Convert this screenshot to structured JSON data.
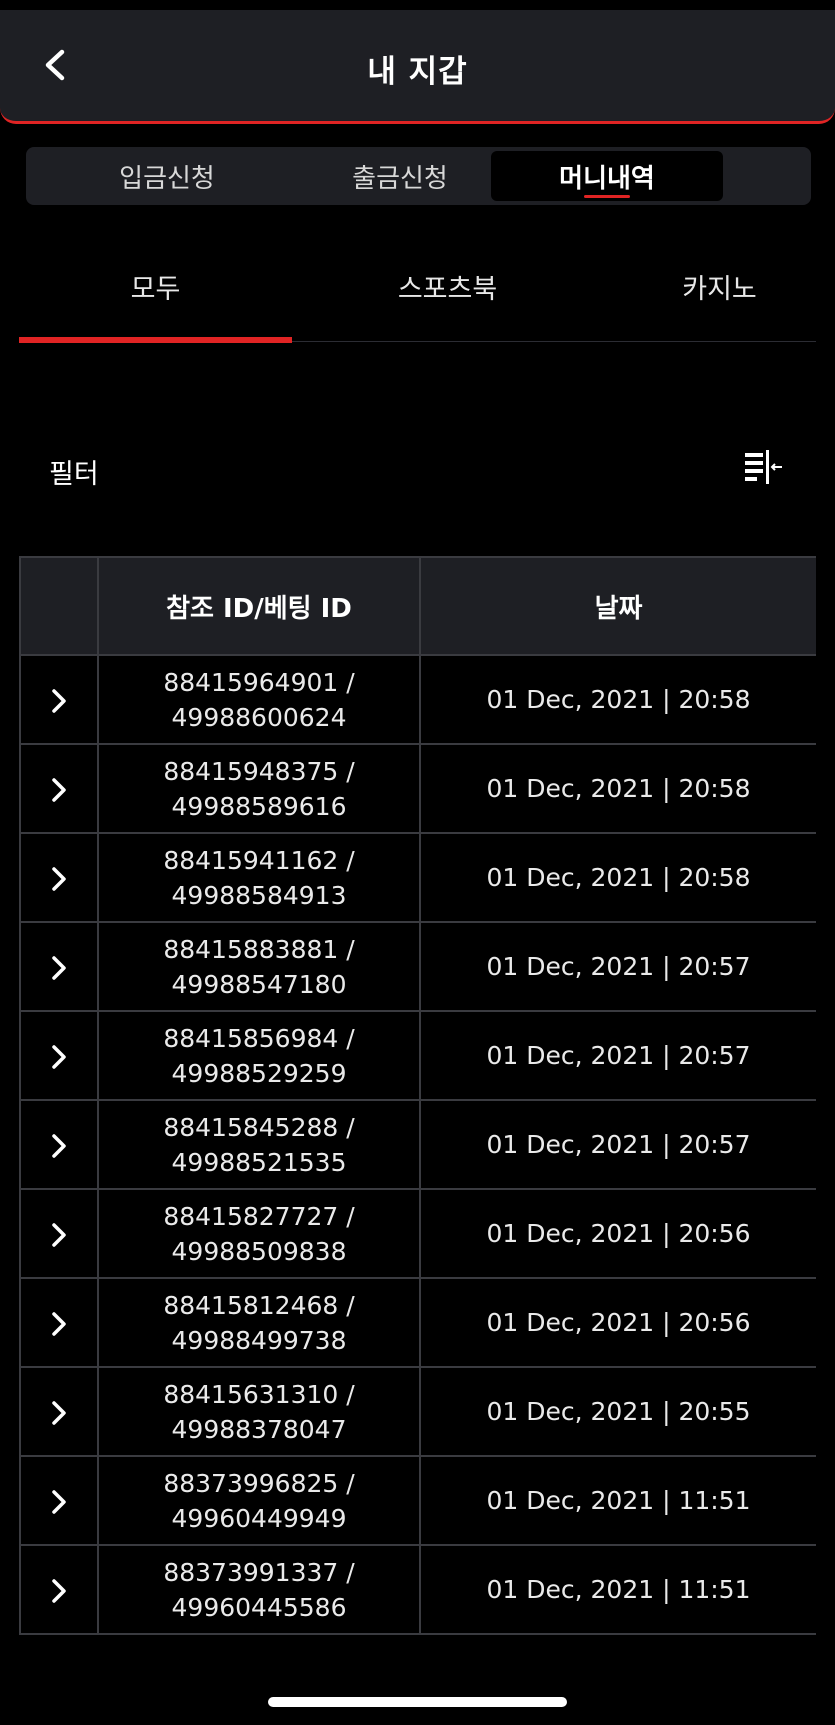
{
  "header": {
    "title": "내 지갑",
    "back_icon": "chevron-left-icon"
  },
  "segments": [
    {
      "label": "입금신청",
      "active": false
    },
    {
      "label": "출금신청",
      "active": false
    },
    {
      "label": "머니내역",
      "active": true
    }
  ],
  "tabs": [
    {
      "label": "모두",
      "active": true
    },
    {
      "label": "스포츠북",
      "active": false
    },
    {
      "label": "카지노",
      "active": false
    }
  ],
  "filter": {
    "label": "필터",
    "icon": "filter-collapse-icon"
  },
  "table": {
    "headers": [
      "",
      "참조 ID/베팅 ID",
      "날짜"
    ],
    "rows": [
      {
        "ref_id": "88415964901 /",
        "bet_id": "49988600624",
        "date": "01 Dec, 2021 | 20:58"
      },
      {
        "ref_id": "88415948375 /",
        "bet_id": "49988589616",
        "date": "01 Dec, 2021 | 20:58"
      },
      {
        "ref_id": "88415941162 /",
        "bet_id": "49988584913",
        "date": "01 Dec, 2021 | 20:58"
      },
      {
        "ref_id": "88415883881 /",
        "bet_id": "49988547180",
        "date": "01 Dec, 2021 | 20:57"
      },
      {
        "ref_id": "88415856984 /",
        "bet_id": "49988529259",
        "date": "01 Dec, 2021 | 20:57"
      },
      {
        "ref_id": "88415845288 /",
        "bet_id": "49988521535",
        "date": "01 Dec, 2021 | 20:57"
      },
      {
        "ref_id": "88415827727 /",
        "bet_id": "49988509838",
        "date": "01 Dec, 2021 | 20:56"
      },
      {
        "ref_id": "88415812468 /",
        "bet_id": "49988499738",
        "date": "01 Dec, 2021 | 20:56"
      },
      {
        "ref_id": "88415631310 /",
        "bet_id": "49988378047",
        "date": "01 Dec, 2021 | 20:55"
      },
      {
        "ref_id": "88373996825 /",
        "bet_id": "49960449949",
        "date": "01 Dec, 2021 | 11:51"
      },
      {
        "ref_id": "88373991337 /",
        "bet_id": "49960445586",
        "date": "01 Dec, 2021 | 11:51"
      }
    ]
  },
  "colors": {
    "background": "#000000",
    "panel": "#1e1f24",
    "accent": "#e02424",
    "border": "#3a3b40"
  }
}
